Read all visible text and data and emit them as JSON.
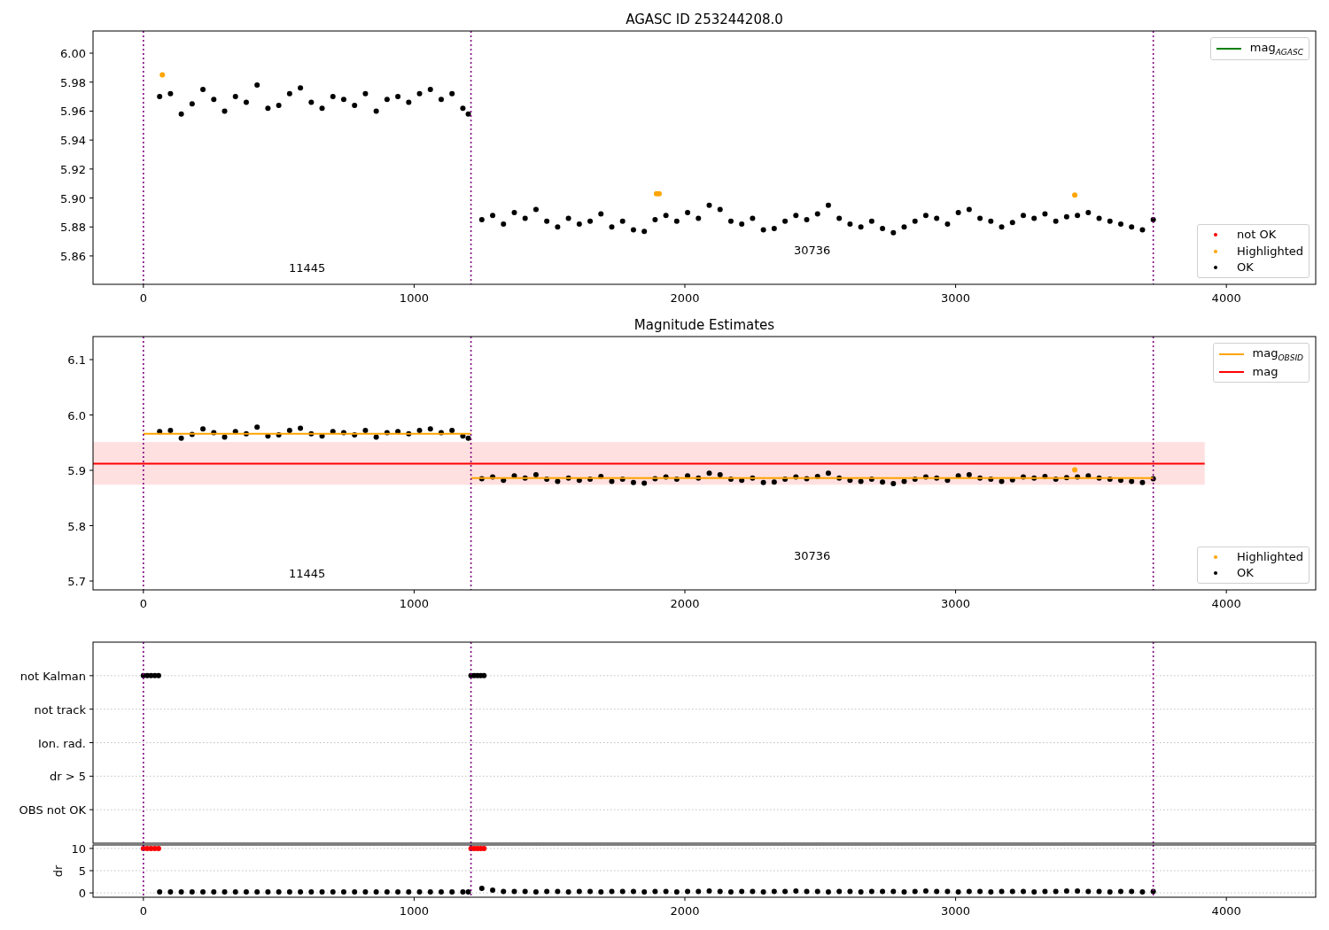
{
  "panels": [
    {
      "chart_data": {
        "type": "scatter",
        "title": "AGASC ID 253244208.0",
        "xlim": [
          -186,
          4330
        ],
        "ylim": [
          5.8404,
          6.0153
        ],
        "xticks": [
          0,
          1000,
          2000,
          3000,
          4000
        ],
        "yticks": [
          {
            "value": 5.86,
            "label": "5.86"
          },
          {
            "value": 5.88,
            "label": "5.88"
          },
          {
            "value": 5.9,
            "label": "5.90"
          },
          {
            "value": 5.92,
            "label": "5.92"
          },
          {
            "value": 5.94,
            "label": "5.94"
          },
          {
            "value": 5.96,
            "label": "5.96"
          },
          {
            "value": 5.98,
            "label": "5.98"
          },
          {
            "value": 6.0,
            "label": "6.00"
          }
        ],
        "series": [
          {
            "type": "scatter",
            "color": "#000000",
            "x": [
              60,
              100,
              140,
              180,
              220,
              260,
              300,
              340,
              380,
              420,
              460,
              500,
              540,
              580,
              620,
              660,
              700,
              740,
              780,
              820,
              860,
              900,
              940,
              980,
              1020,
              1060,
              1100,
              1140,
              1180,
              1200
            ],
            "values": [
              5.97,
              5.972,
              5.958,
              5.965,
              5.975,
              5.968,
              5.96,
              5.97,
              5.966,
              5.978,
              5.962,
              5.964,
              5.972,
              5.976,
              5.966,
              5.962,
              5.97,
              5.968,
              5.964,
              5.972,
              5.96,
              5.968,
              5.97,
              5.966,
              5.972,
              5.975,
              5.968,
              5.972,
              5.962,
              5.958
            ]
          },
          {
            "type": "scatter",
            "color": "#000000",
            "x": [
              1250,
              1290,
              1330,
              1370,
              1410,
              1450,
              1490,
              1530,
              1570,
              1610,
              1650,
              1690,
              1730,
              1770,
              1810,
              1850,
              1890,
              1930,
              1970,
              2010,
              2050,
              2090,
              2130,
              2170,
              2210,
              2250,
              2290,
              2330,
              2370,
              2410,
              2450,
              2490,
              2530,
              2570,
              2610,
              2650,
              2690,
              2730,
              2770,
              2810,
              2850,
              2890,
              2930,
              2970,
              3010,
              3050,
              3090,
              3130,
              3170,
              3210,
              3250,
              3290,
              3330,
              3370,
              3410,
              3450,
              3490,
              3530,
              3570,
              3610,
              3650,
              3690,
              3730
            ],
            "values": [
              5.885,
              5.888,
              5.882,
              5.89,
              5.886,
              5.892,
              5.884,
              5.88,
              5.886,
              5.882,
              5.884,
              5.889,
              5.88,
              5.884,
              5.878,
              5.877,
              5.885,
              5.888,
              5.884,
              5.89,
              5.886,
              5.895,
              5.892,
              5.884,
              5.882,
              5.886,
              5.878,
              5.879,
              5.884,
              5.888,
              5.885,
              5.889,
              5.895,
              5.886,
              5.882,
              5.88,
              5.884,
              5.879,
              5.876,
              5.88,
              5.884,
              5.888,
              5.886,
              5.882,
              5.89,
              5.892,
              5.886,
              5.884,
              5.88,
              5.883,
              5.888,
              5.886,
              5.889,
              5.884,
              5.887,
              5.888,
              5.89,
              5.886,
              5.884,
              5.882,
              5.88,
              5.878,
              5.885
            ]
          },
          {
            "type": "scatter",
            "color": "#ffa500",
            "x": [
              70,
              1895,
              1905,
              3440
            ],
            "values": [
              5.985,
              5.903,
              5.903,
              5.902
            ]
          }
        ],
        "ref_lines": [
          {
            "axis": "x",
            "value": 0,
            "color": "#800080"
          },
          {
            "axis": "x",
            "value": 1210,
            "color": "#800080"
          },
          {
            "axis": "x",
            "value": 3730,
            "color": "#800080"
          }
        ],
        "annotations": [
          "11445",
          "30736"
        ]
      },
      "legends": [
        {
          "entries": [
            {
              "kind": "line",
              "color": "#008000",
              "label": "mag$_{AGASC}$"
            }
          ]
        },
        {
          "entries": [
            {
              "kind": "dot",
              "color": "#ff0000",
              "label": "not OK"
            },
            {
              "kind": "dot",
              "color": "#ffa500",
              "label": "Highlighted"
            },
            {
              "kind": "dot",
              "color": "#000000",
              "label": "OK"
            }
          ]
        }
      ]
    },
    {
      "chart_data": {
        "type": "scatter",
        "title": "Magnitude Estimates",
        "xlim": [
          -186,
          4330
        ],
        "ylim": [
          5.684,
          6.1416
        ],
        "xticks": [
          0,
          1000,
          2000,
          3000,
          4000
        ],
        "yticks": [
          {
            "value": 5.7,
            "label": "5.7"
          },
          {
            "value": 5.8,
            "label": "5.8"
          },
          {
            "value": 5.9,
            "label": "5.9"
          },
          {
            "value": 6.0,
            "label": "6.0"
          },
          {
            "value": 6.1,
            "label": "6.1"
          }
        ],
        "series": [
          {
            "type": "scatter",
            "color": "#000000",
            "x": [
              60,
              100,
              140,
              180,
              220,
              260,
              300,
              340,
              380,
              420,
              460,
              500,
              540,
              580,
              620,
              660,
              700,
              740,
              780,
              820,
              860,
              900,
              940,
              980,
              1020,
              1060,
              1100,
              1140,
              1180,
              1200
            ],
            "values": [
              5.97,
              5.972,
              5.958,
              5.965,
              5.975,
              5.968,
              5.96,
              5.97,
              5.966,
              5.978,
              5.962,
              5.964,
              5.972,
              5.976,
              5.966,
              5.962,
              5.97,
              5.968,
              5.964,
              5.972,
              5.96,
              5.968,
              5.97,
              5.966,
              5.972,
              5.975,
              5.968,
              5.972,
              5.962,
              5.958
            ]
          },
          {
            "type": "scatter",
            "color": "#000000",
            "x": [
              1250,
              1290,
              1330,
              1370,
              1410,
              1450,
              1490,
              1530,
              1570,
              1610,
              1650,
              1690,
              1730,
              1770,
              1810,
              1850,
              1890,
              1930,
              1970,
              2010,
              2050,
              2090,
              2130,
              2170,
              2210,
              2250,
              2290,
              2330,
              2370,
              2410,
              2450,
              2490,
              2530,
              2570,
              2610,
              2650,
              2690,
              2730,
              2770,
              2810,
              2850,
              2890,
              2930,
              2970,
              3010,
              3050,
              3090,
              3130,
              3170,
              3210,
              3250,
              3290,
              3330,
              3370,
              3410,
              3450,
              3490,
              3530,
              3570,
              3610,
              3650,
              3690,
              3730
            ],
            "values": [
              5.885,
              5.888,
              5.882,
              5.89,
              5.886,
              5.892,
              5.884,
              5.88,
              5.886,
              5.882,
              5.884,
              5.889,
              5.88,
              5.884,
              5.878,
              5.877,
              5.885,
              5.888,
              5.884,
              5.89,
              5.886,
              5.895,
              5.892,
              5.884,
              5.882,
              5.886,
              5.878,
              5.879,
              5.884,
              5.888,
              5.885,
              5.889,
              5.895,
              5.886,
              5.882,
              5.88,
              5.884,
              5.879,
              5.876,
              5.88,
              5.884,
              5.888,
              5.886,
              5.882,
              5.89,
              5.892,
              5.886,
              5.884,
              5.88,
              5.883,
              5.888,
              5.886,
              5.889,
              5.884,
              5.887,
              5.888,
              5.89,
              5.886,
              5.884,
              5.882,
              5.88,
              5.878,
              5.885
            ]
          },
          {
            "type": "scatter",
            "color": "#ffa500",
            "x": [
              3440
            ],
            "values": [
              5.901
            ]
          },
          {
            "type": "line",
            "color": "#ffa500",
            "x": [
              0,
              1210
            ],
            "values": [
              5.966,
              5.966
            ]
          },
          {
            "type": "line",
            "color": "#ffa500",
            "x": [
              1210,
              3730
            ],
            "values": [
              5.886,
              5.886
            ]
          },
          {
            "type": "line",
            "color": "#ff0000",
            "x": [
              -186,
              3920
            ],
            "values": [
              5.912,
              5.912
            ]
          }
        ],
        "bands": [
          {
            "axis": "y",
            "from": 5.874,
            "to": 5.951,
            "color": "#ffe0e0"
          }
        ],
        "ref_lines": [
          {
            "axis": "x",
            "value": 0,
            "color": "#800080"
          },
          {
            "axis": "x",
            "value": 1210,
            "color": "#800080"
          },
          {
            "axis": "x",
            "value": 3730,
            "color": "#800080"
          }
        ],
        "annotations": [
          "11445",
          "30736"
        ]
      },
      "legends": [
        {
          "entries": [
            {
              "kind": "line",
              "color": "#ffa500",
              "label": "mag$_{OBSID}$"
            },
            {
              "kind": "line",
              "color": "#ff0000",
              "label": "mag"
            }
          ]
        },
        {
          "entries": [
            {
              "kind": "dot",
              "color": "#ffa500",
              "label": "Highlighted"
            },
            {
              "kind": "dot",
              "color": "#000000",
              "label": "OK"
            }
          ]
        }
      ]
    },
    {
      "chart_data": {
        "type": "scatter",
        "orientation": "horizontal",
        "xlim": [
          -186,
          4330
        ],
        "categories": [
          "not Kalman",
          "not track",
          "Ion. rad.",
          "dr > 5",
          "OBS not OK"
        ],
        "grid": true,
        "series": [
          {
            "type": "scatter",
            "color": "#000000",
            "values": [
              0,
              null,
              null,
              null,
              null
            ]
          },
          {
            "type": "scatter",
            "color": "#000000",
            "values": [
              14,
              null,
              null,
              null,
              null
            ]
          },
          {
            "type": "scatter",
            "color": "#000000",
            "values": [
              28,
              null,
              null,
              null,
              null
            ]
          },
          {
            "type": "scatter",
            "color": "#000000",
            "values": [
              42,
              null,
              null,
              null,
              null
            ]
          },
          {
            "type": "scatter",
            "color": "#000000",
            "values": [
              56,
              null,
              null,
              null,
              null
            ]
          },
          {
            "type": "scatter",
            "color": "#000000",
            "values": [
              1210,
              null,
              null,
              null,
              null
            ]
          },
          {
            "type": "scatter",
            "color": "#000000",
            "values": [
              1222,
              null,
              null,
              null,
              null
            ]
          },
          {
            "type": "scatter",
            "color": "#000000",
            "values": [
              1234,
              null,
              null,
              null,
              null
            ]
          },
          {
            "type": "scatter",
            "color": "#000000",
            "values": [
              1246,
              null,
              null,
              null,
              null
            ]
          },
          {
            "type": "scatter",
            "color": "#000000",
            "values": [
              1258,
              null,
              null,
              null,
              null
            ]
          }
        ],
        "ref_lines": [
          {
            "axis": "x",
            "value": 0,
            "color": "#800080"
          },
          {
            "axis": "x",
            "value": 1210,
            "color": "#800080"
          },
          {
            "axis": "x",
            "value": 3730,
            "color": "#800080"
          }
        ]
      }
    },
    {
      "chart_data": {
        "type": "scatter",
        "ylabel": "dr",
        "xlim": [
          -186,
          4330
        ],
        "ylim": [
          -0.98,
          10.78
        ],
        "grid": true,
        "xticks": [
          0,
          1000,
          2000,
          3000,
          4000
        ],
        "yticks": [
          0,
          5,
          10
        ],
        "series": [
          {
            "type": "scatter",
            "color": "#ff0000",
            "x": [
              0,
              14,
              28,
              42,
              56
            ],
            "values": [
              10,
              10,
              10,
              10,
              10
            ]
          },
          {
            "type": "scatter",
            "color": "#ff0000",
            "x": [
              1210,
              1222,
              1234,
              1246,
              1258
            ],
            "values": [
              10,
              10,
              10,
              10,
              10
            ]
          },
          {
            "type": "scatter",
            "color": "#000000",
            "x": [
              60,
              100,
              140,
              180,
              220,
              260,
              300,
              340,
              380,
              420,
              460,
              500,
              540,
              580,
              620,
              660,
              700,
              740,
              780,
              820,
              860,
              900,
              940,
              980,
              1020,
              1060,
              1100,
              1140,
              1180,
              1200
            ],
            "values": [
              0.2,
              0.2,
              0.2,
              0.2,
              0.2,
              0.2,
              0.2,
              0.2,
              0.2,
              0.2,
              0.2,
              0.2,
              0.2,
              0.2,
              0.2,
              0.2,
              0.2,
              0.2,
              0.2,
              0.2,
              0.2,
              0.2,
              0.2,
              0.2,
              0.2,
              0.2,
              0.2,
              0.2,
              0.2,
              0.2
            ]
          },
          {
            "type": "scatter",
            "color": "#000000",
            "x": [
              1250,
              1290,
              1330,
              1370,
              1410,
              1450,
              1490,
              1530,
              1570,
              1610,
              1650,
              1690,
              1730,
              1770,
              1810,
              1850,
              1890,
              1930,
              1970,
              2010,
              2050,
              2090,
              2130,
              2170,
              2210,
              2250,
              2290,
              2330,
              2370,
              2410,
              2450,
              2490,
              2530,
              2570,
              2610,
              2650,
              2690,
              2730,
              2770,
              2810,
              2850,
              2890,
              2930,
              2970,
              3010,
              3050,
              3090,
              3130,
              3170,
              3210,
              3250,
              3290,
              3330,
              3370,
              3410,
              3450,
              3490,
              3530,
              3570,
              3610,
              3650,
              3690,
              3730
            ],
            "values": [
              1.0,
              0.6,
              0.3,
              0.3,
              0.3,
              0.2,
              0.3,
              0.3,
              0.2,
              0.3,
              0.3,
              0.2,
              0.3,
              0.3,
              0.3,
              0.2,
              0.3,
              0.3,
              0.2,
              0.3,
              0.3,
              0.4,
              0.3,
              0.2,
              0.3,
              0.3,
              0.2,
              0.3,
              0.3,
              0.4,
              0.3,
              0.3,
              0.2,
              0.3,
              0.3,
              0.2,
              0.3,
              0.3,
              0.3,
              0.2,
              0.3,
              0.4,
              0.3,
              0.3,
              0.2,
              0.3,
              0.3,
              0.2,
              0.3,
              0.3,
              0.3,
              0.2,
              0.3,
              0.3,
              0.4,
              0.4,
              0.3,
              0.3,
              0.2,
              0.3,
              0.3,
              0.2,
              0.3
            ]
          }
        ],
        "ref_lines": [
          {
            "axis": "x",
            "value": 0,
            "color": "#800080"
          },
          {
            "axis": "x",
            "value": 1210,
            "color": "#800080"
          },
          {
            "axis": "x",
            "value": 3730,
            "color": "#800080"
          }
        ]
      }
    }
  ]
}
